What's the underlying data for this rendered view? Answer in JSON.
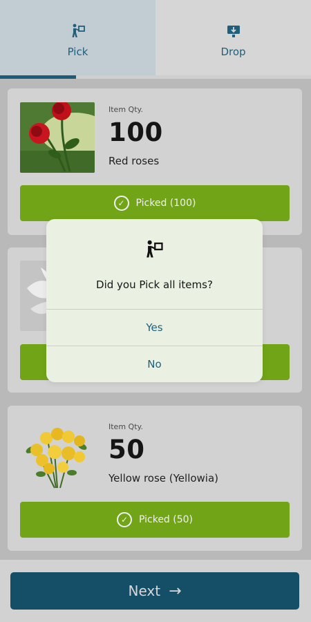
{
  "tabs": [
    {
      "label": "Pick",
      "icon": "pick-person-icon",
      "active": true
    },
    {
      "label": "Drop",
      "icon": "drop-box-icon",
      "active": false
    }
  ],
  "items": [
    {
      "qty_label": "Item Qty.",
      "qty": "100",
      "name": "Red roses",
      "button": "Picked (100)"
    },
    {
      "qty_label": "Item Qty.",
      "qty": "50",
      "name": "Yellow rose (Yellowia)",
      "button": "Picked (50)"
    }
  ],
  "dialog": {
    "title": "Did you Pick all items?",
    "yes": "Yes",
    "no": "No"
  },
  "footer": {
    "next_label": "Next",
    "next_arrow": "→"
  },
  "colors": {
    "accent": "#1c5c78",
    "picked_green": "#71a517",
    "next_button": "#154e67"
  }
}
